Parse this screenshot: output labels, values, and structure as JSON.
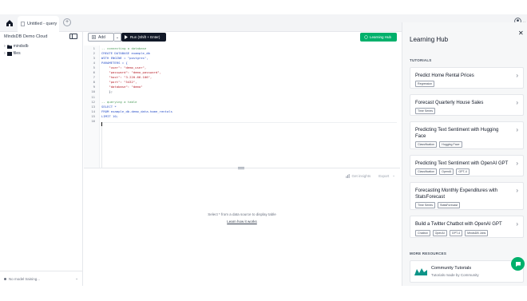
{
  "tabbar": {
    "tab_title": "Untitled - query"
  },
  "sidebar": {
    "title": "MindsDB Demo Cloud",
    "items": [
      {
        "label": "mindsdb"
      },
      {
        "label": "files"
      }
    ],
    "footer": "No model training..."
  },
  "toolbar": {
    "add_label": "Add",
    "run_label": "Run (Shift + Enter)",
    "learning_hub_label": "Learning Hub"
  },
  "editor": {
    "line_numbers": [
      "1",
      "2",
      "3",
      "4",
      "5",
      "6",
      "7",
      "8",
      "9",
      "10",
      "11",
      "12",
      "13",
      "14",
      "15",
      "16"
    ],
    "lines": [
      {
        "cls": "c-com",
        "text": "-- connecting a database"
      },
      {
        "cls": "c-kw",
        "text": "CREATE DATABASE example_db"
      },
      {
        "cls": "c-kw",
        "text": "WITH ENGINE = \"postgres\","
      },
      {
        "cls": "c-kw",
        "text": "PARAMETERS = {"
      },
      {
        "cls": "c-str",
        "text": "    \"user\": \"demo_user\","
      },
      {
        "cls": "c-str",
        "text": "    \"password\": \"demo_password\","
      },
      {
        "cls": "c-str",
        "text": "    \"host\": \"3.220.66.106\","
      },
      {
        "cls": "c-str",
        "text": "    \"port\": \"5432\","
      },
      {
        "cls": "c-str",
        "text": "    \"database\": \"demo\""
      },
      {
        "cls": "c-def",
        "text": "    };"
      },
      {
        "cls": "c-def",
        "text": ""
      },
      {
        "cls": "c-com",
        "text": "-- querying a table"
      },
      {
        "cls": "c-kw",
        "text": "SELECT *"
      },
      {
        "cls": "c-kw",
        "text": "FROM example_db.demo_data.home_rentals"
      },
      {
        "cls": "c-kw",
        "text": "LIMIT 10;"
      },
      {
        "cls": "c-def",
        "text": ""
      }
    ]
  },
  "results": {
    "tool_1": "Get insights",
    "tool_2": "Export",
    "empty_message": "Select * from a data source to display table",
    "empty_link": "Learn how it works"
  },
  "hub": {
    "title": "Learning Hub",
    "tutorials_label": "TUTORIALS",
    "cards": [
      {
        "title": "Predict Home Rental Prices",
        "tags": [
          "Regression"
        ]
      },
      {
        "title": "Forecast Quarterly House Sales",
        "tags": [
          "Time Series"
        ]
      },
      {
        "title": "Predicting Text Sentiment with Hugging Face",
        "tags": [
          "Classification",
          "Hugging Face"
        ]
      },
      {
        "title": "Predicting Text Sentiment with OpenAI GPT",
        "tags": [
          "Classification",
          "OpenAI",
          "GPT-4"
        ]
      },
      {
        "title": "Forecasting Monthly Expenditures with StatsForecast",
        "tags": [
          "Time Series",
          "StatsForecast"
        ]
      },
      {
        "title": "Build a Twitter Chatbot with OpenAI GPT",
        "tags": [
          "Chatbot",
          "OpenAI",
          "GPT-4",
          "MindsDB Jobs"
        ]
      }
    ],
    "more_resources_label": "MORE RESOURCES",
    "resource": {
      "title": "Community Tutorials",
      "subtitle": "Tutorials made by Community"
    }
  },
  "colors": {
    "accent": "#00b06b",
    "run": "#111827"
  }
}
